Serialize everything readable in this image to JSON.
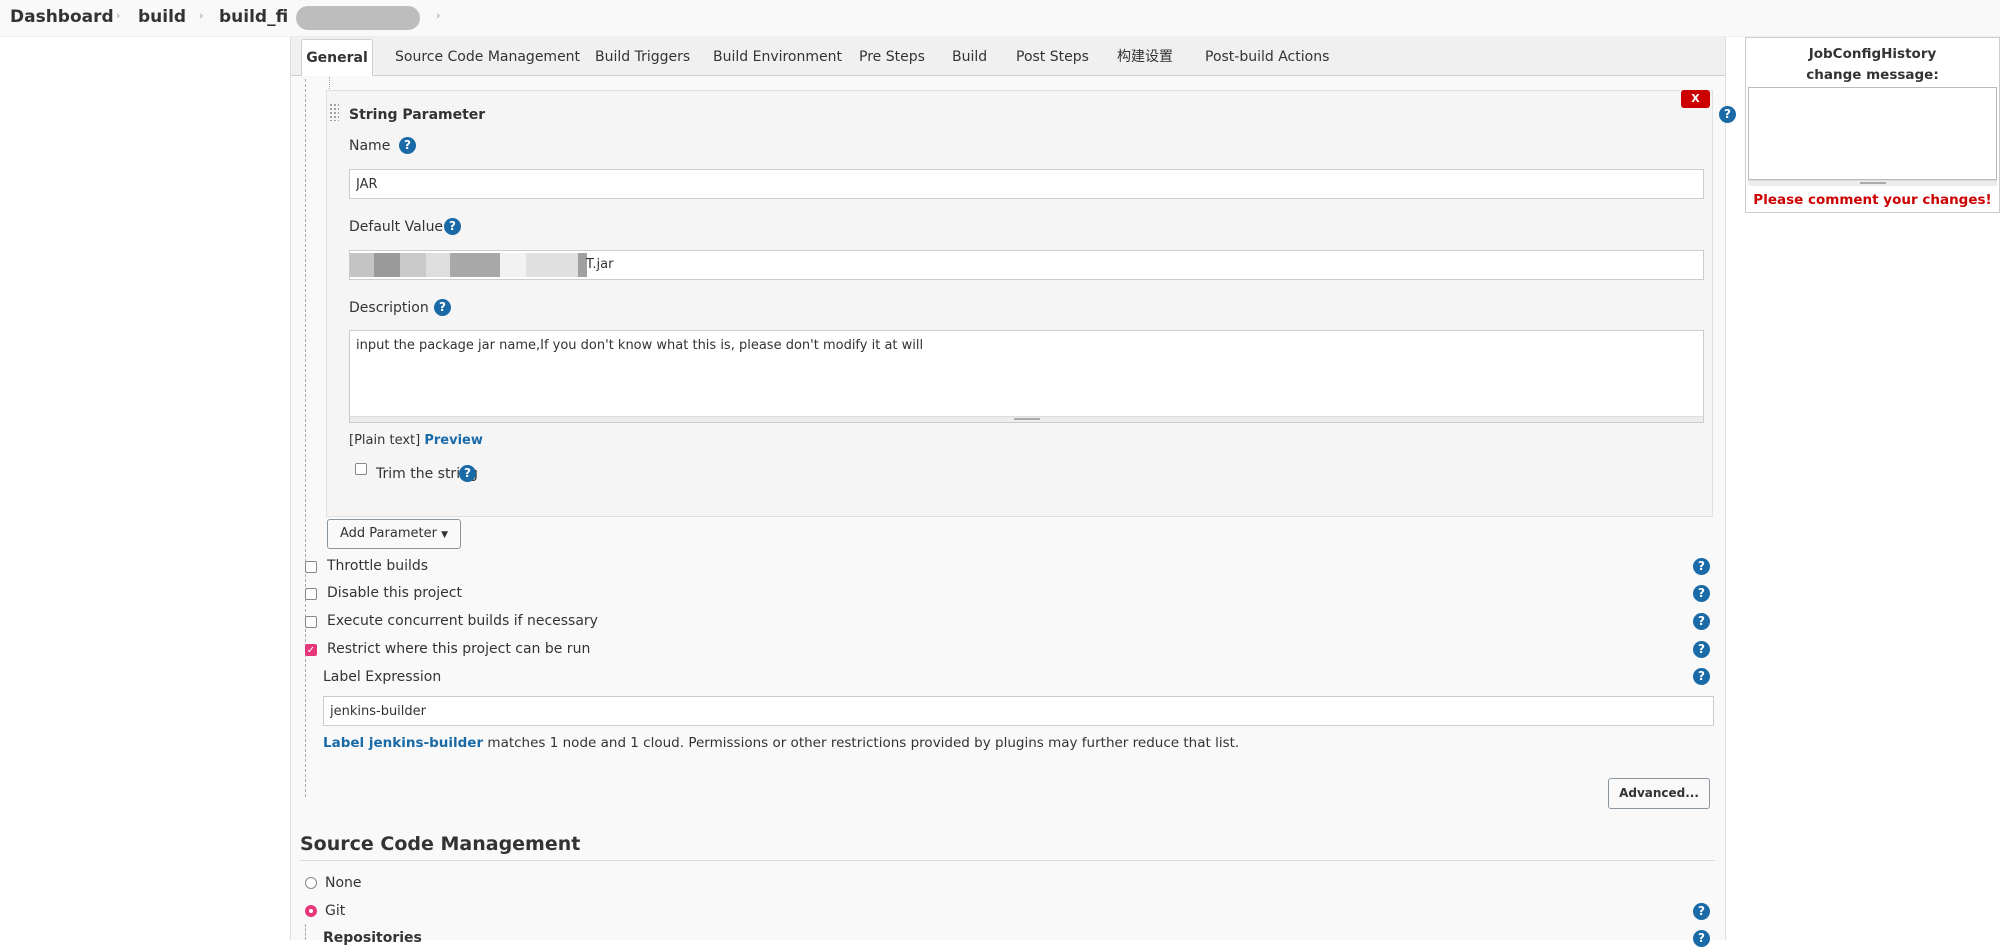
{
  "breadcrumb": {
    "items": [
      "Dashboard",
      "build",
      "build_fi"
    ]
  },
  "tabs": [
    "General",
    "Source Code Management",
    "Build Triggers",
    "Build Environment",
    "Pre Steps",
    "Build",
    "Post Steps",
    "构建设置",
    "Post-build Actions"
  ],
  "string_param": {
    "title": "String Parameter",
    "delete_label": "X",
    "name_label": "Name",
    "name_value": "JAR",
    "default_label": "Default Value",
    "default_value": "T.jar",
    "description_label": "Description",
    "description_value": "input the package jar name,If you don't know what this is, please don't modify it at will",
    "plain_text": "[Plain text]",
    "preview": "Preview",
    "trim_label": "Trim the string"
  },
  "add_parameter": "Add Parameter",
  "options": {
    "throttle": "Throttle builds",
    "disable": "Disable this project",
    "concurrent": "Execute concurrent builds if necessary",
    "restrict": "Restrict where this project can be run"
  },
  "label_expression": {
    "label": "Label Expression",
    "value": "jenkins-builder",
    "match_link": "Label jenkins-builder",
    "match_text": "matches 1 node and 1 cloud. Permissions or other restrictions provided by plugins may further reduce that list."
  },
  "advanced_button": "Advanced...",
  "scm": {
    "heading": "Source Code Management",
    "none": "None",
    "git": "Git",
    "repositories": "Repositories"
  },
  "side": {
    "title_line1": "JobConfigHistory",
    "title_line2": "change message:",
    "warning": "Please comment your changes!"
  },
  "colors": {
    "accent": "#e6377a",
    "link": "#1a6aa8",
    "delete": "#cc0000"
  }
}
